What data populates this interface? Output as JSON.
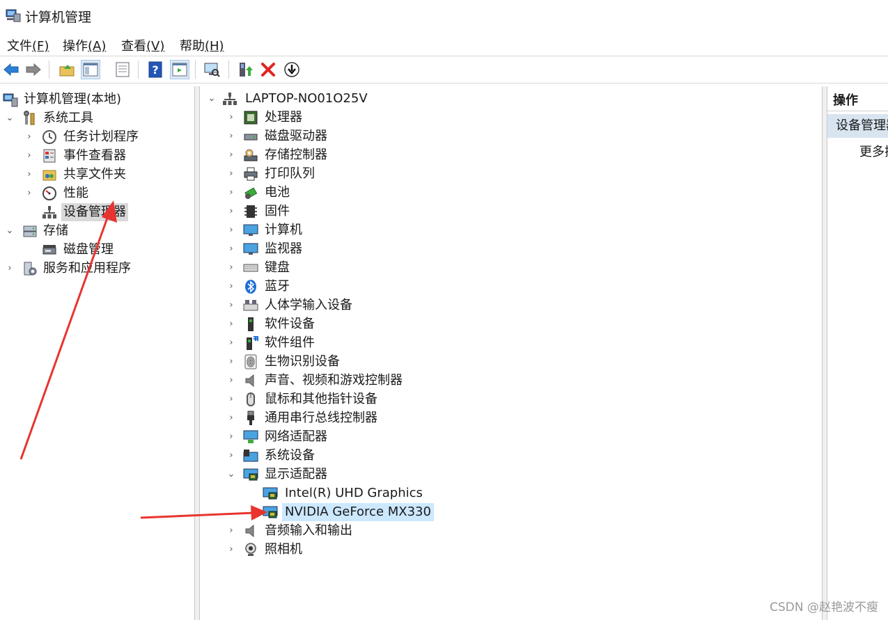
{
  "window": {
    "title": "计算机管理"
  },
  "menu": [
    {
      "label": "文件",
      "key": "(F)"
    },
    {
      "label": "操作",
      "key": "(A)"
    },
    {
      "label": "查看",
      "key": "(V)"
    },
    {
      "label": "帮助",
      "key": "(H)"
    }
  ],
  "tree_left": [
    {
      "label": "计算机管理(本地)",
      "icon": "computer-manage-icon"
    },
    {
      "label": "系统工具",
      "icon": "tools-icon",
      "expanded": true
    },
    {
      "label": "任务计划程序",
      "icon": "clock-icon"
    },
    {
      "label": "事件查看器",
      "icon": "event-viewer-icon"
    },
    {
      "label": "共享文件夹",
      "icon": "shared-folder-icon"
    },
    {
      "label": "性能",
      "icon": "performance-icon"
    },
    {
      "label": "设备管理器",
      "icon": "device-manager-icon",
      "selected": true
    },
    {
      "label": "存储",
      "icon": "storage-icon",
      "expanded": true
    },
    {
      "label": "磁盘管理",
      "icon": "disk-icon"
    },
    {
      "label": "服务和应用程序",
      "icon": "services-icon"
    }
  ],
  "tree_center": [
    {
      "label": "LAPTOP-NO01O25V",
      "icon": "computer-root-icon"
    },
    {
      "label": "处理器",
      "icon": "processor-icon"
    },
    {
      "label": "磁盘驱动器",
      "icon": "disk-drive-icon"
    },
    {
      "label": "存储控制器",
      "icon": "storage-controller-icon"
    },
    {
      "label": "打印队列",
      "icon": "printer-icon"
    },
    {
      "label": "电池",
      "icon": "battery-icon"
    },
    {
      "label": "固件",
      "icon": "firmware-icon"
    },
    {
      "label": "计算机",
      "icon": "computer-icon"
    },
    {
      "label": "监视器",
      "icon": "monitor-icon"
    },
    {
      "label": "键盘",
      "icon": "keyboard-icon"
    },
    {
      "label": "蓝牙",
      "icon": "bluetooth-icon"
    },
    {
      "label": "人体学输入设备",
      "icon": "hid-icon"
    },
    {
      "label": "软件设备",
      "icon": "software-device-icon"
    },
    {
      "label": "软件组件",
      "icon": "software-component-icon"
    },
    {
      "label": "生物识别设备",
      "icon": "biometric-icon"
    },
    {
      "label": "声音、视频和游戏控制器",
      "icon": "sound-icon"
    },
    {
      "label": "鼠标和其他指针设备",
      "icon": "mouse-icon"
    },
    {
      "label": "通用串行总线控制器",
      "icon": "usb-icon"
    },
    {
      "label": "网络适配器",
      "icon": "network-icon"
    },
    {
      "label": "系统设备",
      "icon": "system-device-icon"
    },
    {
      "label": "显示适配器",
      "icon": "display-adapter-icon",
      "expanded": true
    },
    {
      "label": "Intel(R) UHD Graphics",
      "icon": "display-adapter-icon"
    },
    {
      "label": "NVIDIA GeForce MX330",
      "icon": "display-adapter-icon",
      "selected": true
    },
    {
      "label": "音频输入和输出",
      "icon": "audio-io-icon"
    },
    {
      "label": "照相机",
      "icon": "camera-icon"
    }
  ],
  "actions": {
    "header": "操作",
    "section": "设备管理器",
    "more": "更多操作"
  },
  "watermark": "CSDN @赵艳波不瘦",
  "colors": {
    "annotation_arrow": "#e8342f",
    "selection_blue": "#cce8ff",
    "selection_gray": "#d9d9d9",
    "actions_bar": "#d8e4f0"
  }
}
